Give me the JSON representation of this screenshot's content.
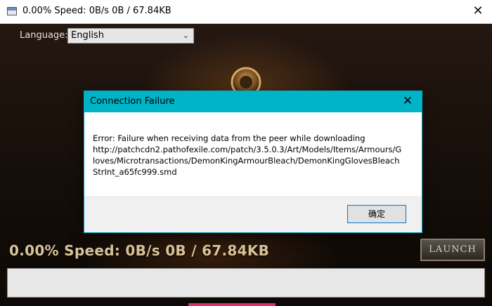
{
  "window": {
    "title": "0.00%  Speed: 0B/s  0B / 67.84KB",
    "icon": "app-window-icon",
    "close_glyph": "✕"
  },
  "launcher": {
    "language_label": "Language:",
    "language_selected": "English",
    "status_text": "0.00%  Speed: 0B/s  0B / 67.84KB",
    "launch_label": "LAUNCH",
    "progress_fraction": 0.0
  },
  "dialog": {
    "title": "Connection Failure",
    "close_glyph": "✕",
    "message": "Error: Failure when receiving data from the peer while downloading http://patchcdn2.pathofexile.com/patch/3.5.0.3/Art/Models/Items/Armours/Gloves/Microtransactions/DemonKingArmourBleach/DemonKingGlovesBleachStrInt_a65fc999.smd",
    "ok_label": "确定"
  },
  "colors": {
    "dialog_header": "#00b4c8",
    "ok_border": "#0078d7",
    "status_text": "#d9c49a"
  }
}
